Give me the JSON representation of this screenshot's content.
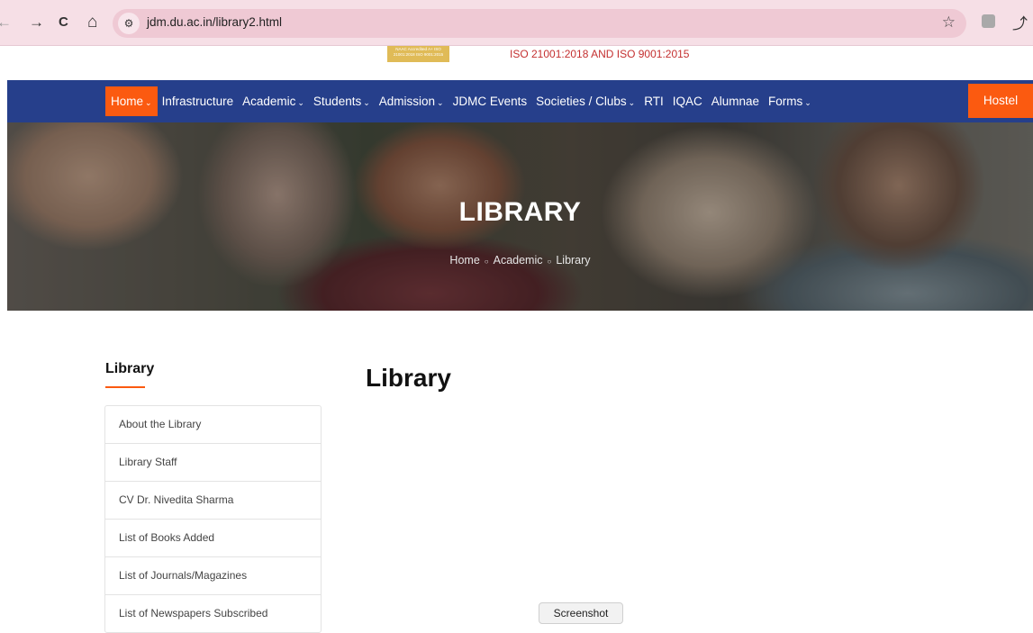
{
  "browser": {
    "url": "jdm.du.ac.in/library2.html",
    "back_icon": "←",
    "forward_icon": "→",
    "reload_icon": "C",
    "home_icon": "⌂",
    "site_info_icon": "⚙",
    "star_icon": "☆",
    "ext_icon": "⤴"
  },
  "header": {
    "badge_text": "NAAC Accredited A+ ISO 21001:2018 ISO 9001:2015",
    "iso_text": "ISO 21001:2018 AND ISO 9001:2015"
  },
  "nav": {
    "items": [
      {
        "label": "Home",
        "caret": "⌄"
      },
      {
        "label": "Infrastructure",
        "caret": ""
      },
      {
        "label": "Academic",
        "caret": "⌄"
      },
      {
        "label": "Students",
        "caret": "⌄"
      },
      {
        "label": "Admission",
        "caret": "⌄"
      },
      {
        "label": "JDMC Events",
        "caret": ""
      },
      {
        "label": "Societies / Clubs",
        "caret": "⌄"
      },
      {
        "label": "RTI",
        "caret": ""
      },
      {
        "label": "IQAC",
        "caret": ""
      },
      {
        "label": "Alumnae",
        "caret": ""
      },
      {
        "label": "Forms",
        "caret": "⌄"
      }
    ],
    "hostel": "Hostel"
  },
  "hero": {
    "title": "LIBRARY",
    "breadcrumb": [
      "Home",
      "Academic",
      "Library"
    ],
    "sep": "○"
  },
  "sidebar": {
    "title": "Library",
    "items": [
      "About the Library",
      "Library Staff",
      "CV Dr. Nivedita Sharma",
      "List of Books Added",
      "List of Journals/Magazines",
      "List of Newspapers Subscribed"
    ]
  },
  "content": {
    "title": "Library"
  },
  "overlay": {
    "screenshot_label": "Screenshot"
  },
  "colors": {
    "nav_bg": "#263f8b",
    "accent": "#fb5a10",
    "browser_bar": "#f6dfe6"
  }
}
